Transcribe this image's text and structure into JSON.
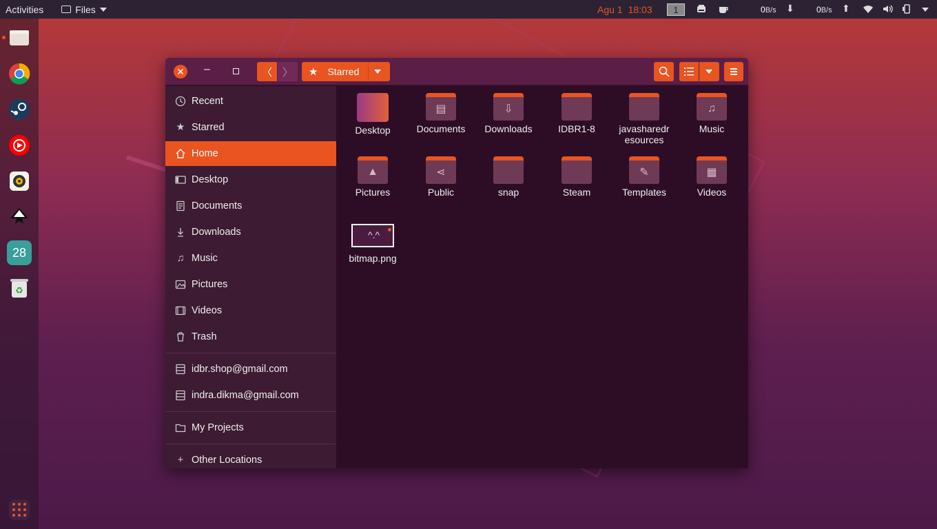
{
  "topbar": {
    "activities": "Activities",
    "app_menu": "Files",
    "date": "Agu 1",
    "time": "18:03",
    "workspace": "1",
    "net_down_value": "0",
    "net_down_unit": "B/s",
    "net_up_value": "0",
    "net_up_unit": "B/s"
  },
  "dock": {
    "items": [
      "files-icon",
      "chrome-icon",
      "steam-icon",
      "youtube-music-icon",
      "rhythmbox-icon",
      "inkscape-icon",
      "calendar-icon",
      "trash-icon"
    ],
    "calendar_day": "28"
  },
  "window": {
    "path_label": "Starred"
  },
  "sidebar": {
    "places": [
      {
        "label": "Recent",
        "icon": "clock-icon"
      },
      {
        "label": "Starred",
        "icon": "star-icon"
      },
      {
        "label": "Home",
        "icon": "home-icon",
        "active": true
      },
      {
        "label": "Desktop",
        "icon": "desktop-icon"
      },
      {
        "label": "Documents",
        "icon": "document-icon"
      },
      {
        "label": "Downloads",
        "icon": "download-icon"
      },
      {
        "label": "Music",
        "icon": "music-icon"
      },
      {
        "label": "Pictures",
        "icon": "picture-icon"
      },
      {
        "label": "Videos",
        "icon": "video-icon"
      },
      {
        "label": "Trash",
        "icon": "trash-icon"
      }
    ],
    "accounts": [
      {
        "label": "idbr.shop@gmail.com",
        "icon": "network-drive-icon"
      },
      {
        "label": "indra.dikma@gmail.com",
        "icon": "network-drive-icon"
      }
    ],
    "bookmarks": [
      {
        "label": "My Projects",
        "icon": "folder-icon"
      }
    ],
    "other": {
      "label": "Other Locations",
      "icon": "plus-icon"
    }
  },
  "files": [
    {
      "name": "Desktop",
      "type": "desktop"
    },
    {
      "name": "Documents",
      "type": "folder",
      "glyph": "document"
    },
    {
      "name": "Downloads",
      "type": "folder",
      "glyph": "download"
    },
    {
      "name": "IDBR1-8",
      "type": "folder",
      "glyph": ""
    },
    {
      "name_line1": "javasharedr",
      "name_line2": "esources",
      "type": "folder",
      "glyph": ""
    },
    {
      "name": "Music",
      "type": "folder",
      "glyph": "music"
    },
    {
      "name": "Pictures",
      "type": "folder",
      "glyph": "picture"
    },
    {
      "name": "Public",
      "type": "folder",
      "glyph": "share"
    },
    {
      "name": "snap",
      "type": "folder",
      "glyph": ""
    },
    {
      "name": "Steam",
      "type": "folder",
      "glyph": ""
    },
    {
      "name": "Templates",
      "type": "folder",
      "glyph": "template"
    },
    {
      "name": "Videos",
      "type": "folder",
      "glyph": "video"
    },
    {
      "name": "bitmap.png",
      "type": "image"
    }
  ],
  "colors": {
    "accent": "#e95420",
    "headerbar": "#5a1e47",
    "sidebar": "#3d1b33",
    "content": "#2d0d25"
  }
}
